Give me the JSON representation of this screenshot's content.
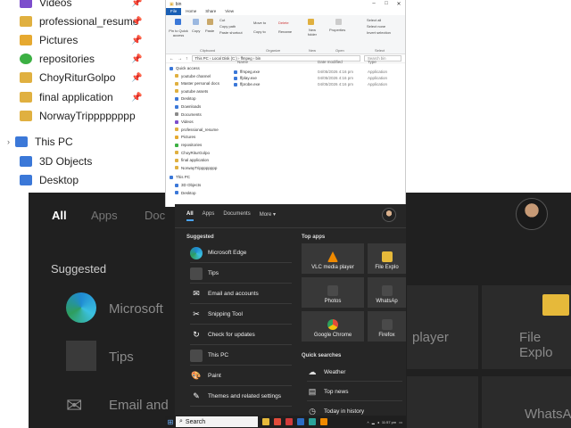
{
  "background": {
    "quick_items": [
      {
        "label": "Videos",
        "color": "#7c4dcc"
      },
      {
        "label": "professional_resume",
        "color": "#e0b040"
      },
      {
        "label": "Pictures",
        "color": "#e6a930"
      },
      {
        "label": "repositories",
        "color": "#3cb043"
      },
      {
        "label": "ChoyRiturGolpo",
        "color": "#e0b040"
      },
      {
        "label": "final application",
        "color": "#e0b040"
      },
      {
        "label": "NorwayTripppppppp",
        "color": "#e0b040"
      }
    ],
    "this_pc": "This PC",
    "pc_items": [
      "3D Objects",
      "Desktop"
    ],
    "tabs": [
      "All",
      "Apps",
      "Doc"
    ],
    "suggested": "Suggested",
    "items": [
      "Microsoft",
      "Tips",
      "Email and"
    ],
    "right_tiles": [
      "player",
      "File Explo",
      "WhatsAp"
    ]
  },
  "explorer": {
    "title": "bin",
    "tabs": [
      "File",
      "Home",
      "Share",
      "View"
    ],
    "ribbon": {
      "pin": "Pin to Quick access",
      "copy": "Copy",
      "paste": "Paste",
      "cut": "Cut",
      "copy_path": "Copy path",
      "paste_shortcut": "Paste shortcut",
      "clipboard": "Clipboard",
      "move_to": "Move to",
      "copy_to": "Copy to",
      "delete": "Delete",
      "rename": "Rename",
      "organize": "Organize",
      "new_folder": "New folder",
      "new": "New",
      "properties": "Properties",
      "open": "Open",
      "select_all": "Select all",
      "select_none": "Select none",
      "invert_selection": "Invert selection",
      "select": "Select"
    },
    "address": "This PC  ›  Local Disk (C:)  ›  ffmpeg  ›  bin",
    "search_placeholder": "Search bin",
    "columns": {
      "name": "Name",
      "date": "Date modified",
      "type": "Type"
    },
    "files": [
      {
        "name": "ffmpeg.exe",
        "date": "04/05/2026 4:16 pm",
        "type": "Application"
      },
      {
        "name": "ffplay.exe",
        "date": "04/05/2026 4:16 pm",
        "type": "Application"
      },
      {
        "name": "ffprobe.exe",
        "date": "04/05/2026 4:16 pm",
        "type": "Application"
      }
    ],
    "nav": [
      {
        "label": "Quick access",
        "color": "#3b78d8"
      },
      {
        "label": "youtube channel",
        "color": "#e0b040"
      },
      {
        "label": "Master personal docs",
        "color": "#e0b040"
      },
      {
        "label": "youtube assets",
        "color": "#e0b040"
      },
      {
        "label": "Desktop",
        "color": "#3b78d8"
      },
      {
        "label": "Downloads",
        "color": "#3b78d8"
      },
      {
        "label": "Documents",
        "color": "#8a8a8a"
      },
      {
        "label": "Videos",
        "color": "#7c4dcc"
      },
      {
        "label": "professional_resume",
        "color": "#e0b040"
      },
      {
        "label": "Pictures",
        "color": "#e6a930"
      },
      {
        "label": "repositories",
        "color": "#3cb043"
      },
      {
        "label": "ChoyRiturGolpo",
        "color": "#e0b040"
      },
      {
        "label": "final application",
        "color": "#e0b040"
      },
      {
        "label": "NorwayTripppppppp",
        "color": "#e0b040"
      },
      {
        "label": "This PC",
        "color": "#3b78d8"
      },
      {
        "label": "3D Objects",
        "color": "#3b78d8"
      },
      {
        "label": "Desktop",
        "color": "#3b78d8"
      }
    ]
  },
  "start_menu": {
    "tabs": [
      "All",
      "Apps",
      "Documents",
      "More ▾"
    ],
    "suggested_title": "Suggested",
    "suggested": [
      {
        "label": "Microsoft Edge",
        "icon": "edge-icon",
        "color": "#1f8ad2",
        "glyph": ""
      },
      {
        "label": "Tips",
        "icon": "tips-icon",
        "color": "#4a4a4a",
        "glyph": ""
      },
      {
        "label": "Email and accounts",
        "icon": "mail-icon",
        "color": "transparent",
        "glyph": "✉"
      },
      {
        "label": "Snipping Tool",
        "icon": "snipping-tool-icon",
        "color": "transparent",
        "glyph": "✂"
      },
      {
        "label": "Check for updates",
        "icon": "refresh-icon",
        "color": "transparent",
        "glyph": "↻"
      },
      {
        "label": "This PC",
        "icon": "this-pc-icon",
        "color": "#4a4a4a",
        "glyph": ""
      },
      {
        "label": "Paint",
        "icon": "paint-icon",
        "color": "transparent",
        "glyph": "🎨"
      },
      {
        "label": "Themes and related settings",
        "icon": "brush-icon",
        "color": "transparent",
        "glyph": "✎"
      }
    ],
    "top_apps_title": "Top apps",
    "top_apps": [
      {
        "label": "VLC media player",
        "icon": "vlc-icon",
        "color": "#f08a00"
      },
      {
        "label": "File Explo",
        "icon": "file-explorer-icon",
        "color": "#e6b93a"
      },
      {
        "label": "Photos",
        "icon": "photos-icon",
        "color": "#4a4a4a"
      },
      {
        "label": "WhatsAp",
        "icon": "whatsapp-icon",
        "color": "#4a4a4a"
      },
      {
        "label": "Google Chrome",
        "icon": "chrome-icon",
        "color": "#e24b3a"
      },
      {
        "label": "Firefox",
        "icon": "firefox-icon",
        "color": "#4a4a4a"
      }
    ],
    "quick_searches_title": "Quick searches",
    "quick_searches": [
      {
        "label": "Weather",
        "icon": "weather-icon",
        "glyph": "☁"
      },
      {
        "label": "Top news",
        "icon": "news-icon",
        "glyph": "▤"
      },
      {
        "label": "Today in history",
        "icon": "clock-icon",
        "glyph": "◷"
      }
    ]
  },
  "taskbar": {
    "search_text": "Search",
    "apps": [
      {
        "icon": "file-explorer-icon",
        "color": "#e6b93a"
      },
      {
        "icon": "chrome-icon",
        "color": "#e24b3a"
      },
      {
        "icon": "app-icon-red",
        "color": "#d23b3b"
      },
      {
        "icon": "app-icon-blue",
        "color": "#2b6cc4"
      },
      {
        "icon": "app-icon-teal",
        "color": "#2aa39a"
      },
      {
        "icon": "vlc-icon",
        "color": "#f08a00"
      }
    ],
    "time": "11:57 pm"
  }
}
